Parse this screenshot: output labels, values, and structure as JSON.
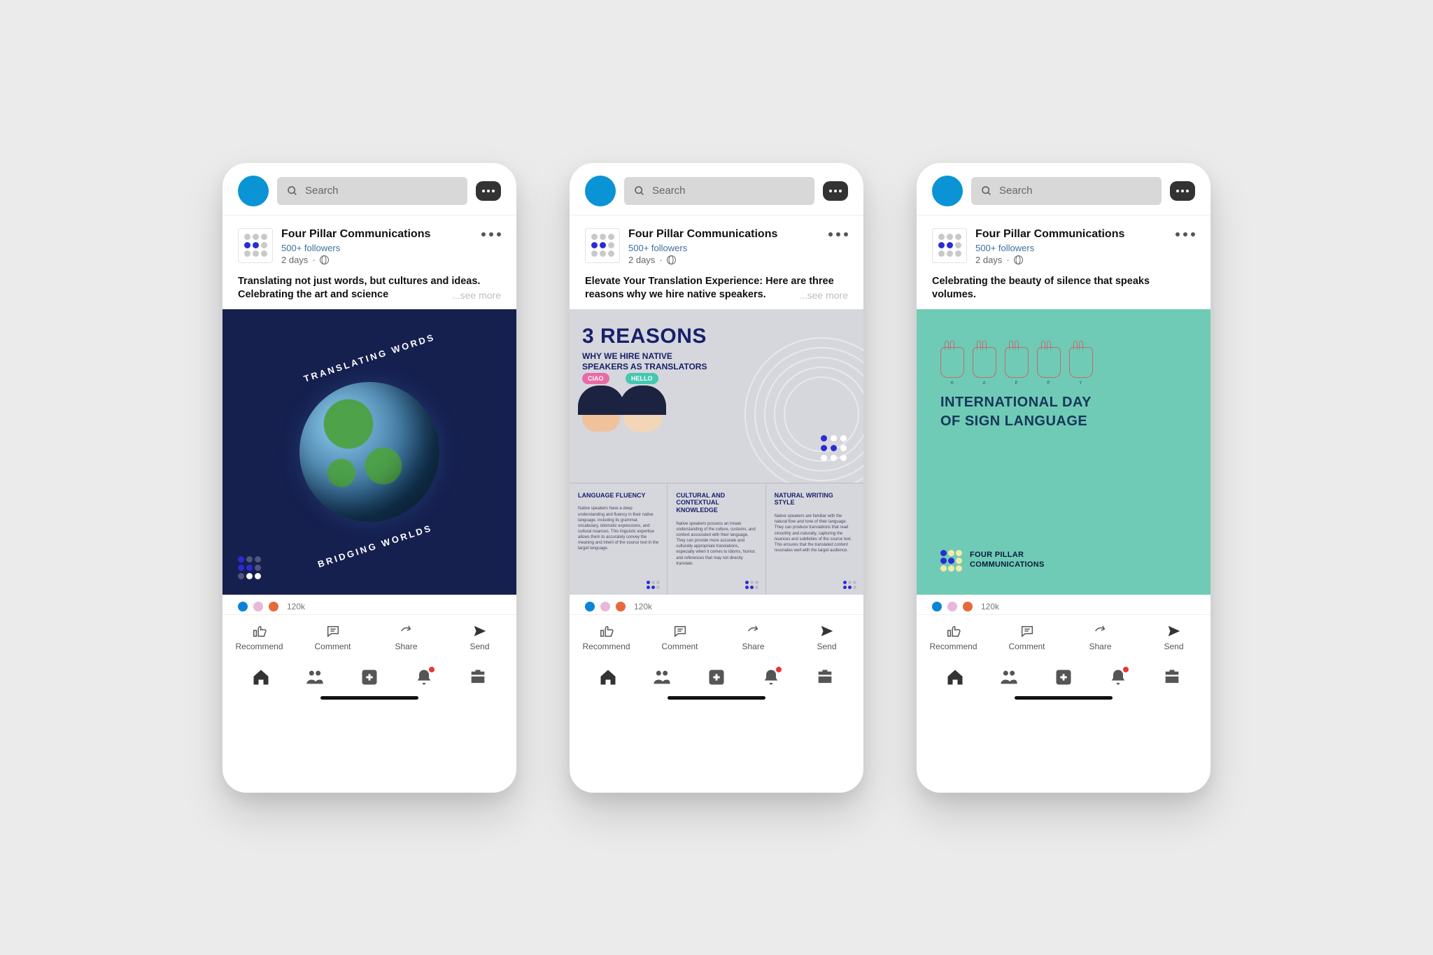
{
  "search_placeholder": "Search",
  "reaction_count": "120k",
  "author": {
    "name": "Four Pillar Communications",
    "followers": "500+ followers",
    "time": "2 days"
  },
  "actions": {
    "recommend": "Recommend",
    "comment": "Comment",
    "share": "Share",
    "send": "Send"
  },
  "see_more": "...see more",
  "posts": [
    {
      "caption": "Translating not just words, but cultures and ideas. Celebrating the art and science",
      "image": {
        "arc_top": "TRANSLATING WORDS",
        "arc_bottom": "BRIDGING WORLDS"
      }
    },
    {
      "caption": "Elevate Your Translation Experience: Here are three reasons why we hire native speakers.",
      "image": {
        "title": "3 REASONS",
        "subtitle": "WHY WE HIRE NATIVE SPEAKERS AS TRANSLATORS",
        "bubble_a": "CIAO",
        "bubble_b": "HELLO",
        "cols": [
          {
            "h": "LANGUAGE FLUENCY",
            "p": "Native speakers have a deep understanding and fluency in their native language, including its grammar, vocabulary, idiomatic expressions, and cultural nuances. This linguistic expertise allows them to accurately convey the meaning and intent of the source text in the target language."
          },
          {
            "h": "CULTURAL AND CONTEXTUAL KNOWLEDGE",
            "p": "Native speakers possess an innate understanding of the culture, customs, and context associated with their language. They can provide more accurate and culturally appropriate translations, especially when it comes to idioms, humor, and references that may not directly translate."
          },
          {
            "h": "NATURAL WRITING STYLE",
            "p": "Native speakers are familiar with the natural flow and tone of their language. They can produce translations that read smoothly and naturally, capturing the nuances and subtleties of the source text. This ensures that the translated content resonates well with the target audience."
          }
        ]
      }
    },
    {
      "caption": "Celebrating the beauty of silence that speaks volumes.",
      "image": {
        "hand_letters": [
          "H",
          "A",
          "P",
          "P",
          "Y"
        ],
        "title_a": "INTERNATIONAL DAY",
        "title_b": "OF SIGN LANGUAGE",
        "brand_a": "FOUR PILLAR",
        "brand_b": "COMMUNICATIONS"
      }
    }
  ]
}
